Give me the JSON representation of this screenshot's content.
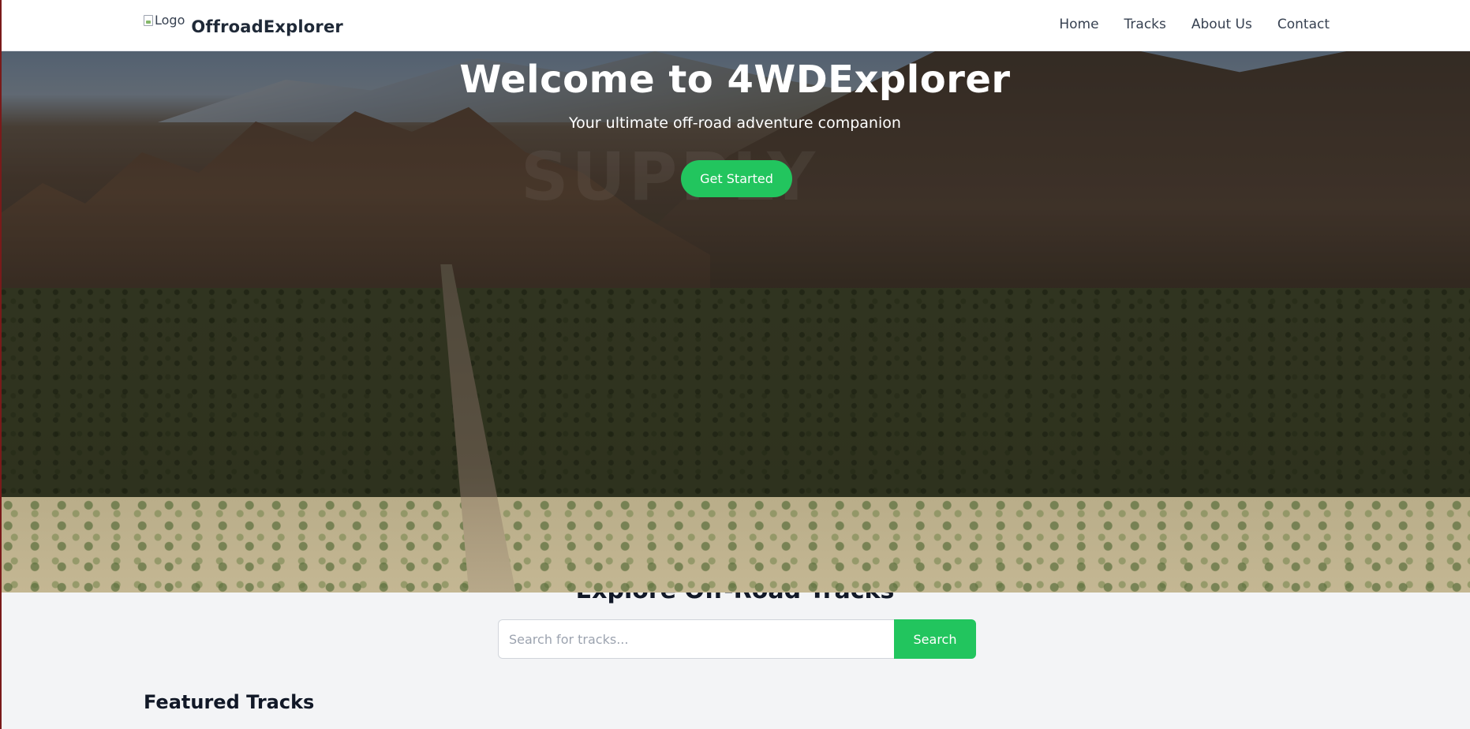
{
  "navbar": {
    "logo_alt": "Logo",
    "brand_name": "OffroadExplorer",
    "links": [
      {
        "label": "Home"
      },
      {
        "label": "Tracks"
      },
      {
        "label": "About Us"
      },
      {
        "label": "Contact"
      }
    ]
  },
  "hero": {
    "title": "Welcome to 4WDExplorer",
    "subtitle": "Your ultimate off-road adventure companion",
    "cta_label": "Get Started",
    "watermark": "SUPPLY"
  },
  "explore": {
    "title": "Explore Off-Road Tracks",
    "search_placeholder": "Search for tracks...",
    "search_value": "",
    "search_button_label": "Search"
  },
  "featured": {
    "title": "Featured Tracks"
  },
  "colors": {
    "accent": "#22c55e",
    "nav_text": "#374151",
    "page_bg": "#f3f4f6"
  }
}
